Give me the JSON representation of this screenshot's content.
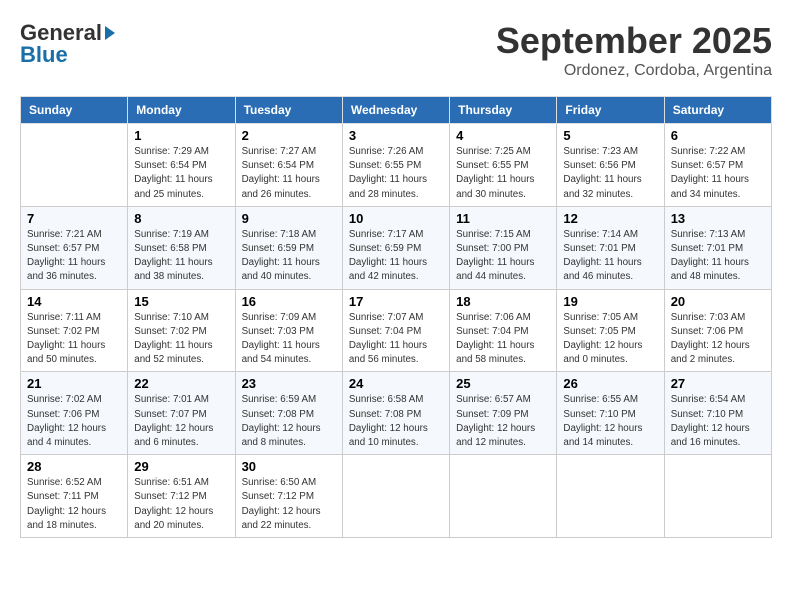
{
  "logo": {
    "line1": "General",
    "line2": "Blue"
  },
  "title": "September 2025",
  "location": "Ordonez, Cordoba, Argentina",
  "days_of_week": [
    "Sunday",
    "Monday",
    "Tuesday",
    "Wednesday",
    "Thursday",
    "Friday",
    "Saturday"
  ],
  "weeks": [
    [
      {
        "day": "",
        "sunrise": "",
        "sunset": "",
        "daylight": ""
      },
      {
        "day": "1",
        "sunrise": "Sunrise: 7:29 AM",
        "sunset": "Sunset: 6:54 PM",
        "daylight": "Daylight: 11 hours and 25 minutes."
      },
      {
        "day": "2",
        "sunrise": "Sunrise: 7:27 AM",
        "sunset": "Sunset: 6:54 PM",
        "daylight": "Daylight: 11 hours and 26 minutes."
      },
      {
        "day": "3",
        "sunrise": "Sunrise: 7:26 AM",
        "sunset": "Sunset: 6:55 PM",
        "daylight": "Daylight: 11 hours and 28 minutes."
      },
      {
        "day": "4",
        "sunrise": "Sunrise: 7:25 AM",
        "sunset": "Sunset: 6:55 PM",
        "daylight": "Daylight: 11 hours and 30 minutes."
      },
      {
        "day": "5",
        "sunrise": "Sunrise: 7:23 AM",
        "sunset": "Sunset: 6:56 PM",
        "daylight": "Daylight: 11 hours and 32 minutes."
      },
      {
        "day": "6",
        "sunrise": "Sunrise: 7:22 AM",
        "sunset": "Sunset: 6:57 PM",
        "daylight": "Daylight: 11 hours and 34 minutes."
      }
    ],
    [
      {
        "day": "7",
        "sunrise": "Sunrise: 7:21 AM",
        "sunset": "Sunset: 6:57 PM",
        "daylight": "Daylight: 11 hours and 36 minutes."
      },
      {
        "day": "8",
        "sunrise": "Sunrise: 7:19 AM",
        "sunset": "Sunset: 6:58 PM",
        "daylight": "Daylight: 11 hours and 38 minutes."
      },
      {
        "day": "9",
        "sunrise": "Sunrise: 7:18 AM",
        "sunset": "Sunset: 6:59 PM",
        "daylight": "Daylight: 11 hours and 40 minutes."
      },
      {
        "day": "10",
        "sunrise": "Sunrise: 7:17 AM",
        "sunset": "Sunset: 6:59 PM",
        "daylight": "Daylight: 11 hours and 42 minutes."
      },
      {
        "day": "11",
        "sunrise": "Sunrise: 7:15 AM",
        "sunset": "Sunset: 7:00 PM",
        "daylight": "Daylight: 11 hours and 44 minutes."
      },
      {
        "day": "12",
        "sunrise": "Sunrise: 7:14 AM",
        "sunset": "Sunset: 7:01 PM",
        "daylight": "Daylight: 11 hours and 46 minutes."
      },
      {
        "day": "13",
        "sunrise": "Sunrise: 7:13 AM",
        "sunset": "Sunset: 7:01 PM",
        "daylight": "Daylight: 11 hours and 48 minutes."
      }
    ],
    [
      {
        "day": "14",
        "sunrise": "Sunrise: 7:11 AM",
        "sunset": "Sunset: 7:02 PM",
        "daylight": "Daylight: 11 hours and 50 minutes."
      },
      {
        "day": "15",
        "sunrise": "Sunrise: 7:10 AM",
        "sunset": "Sunset: 7:02 PM",
        "daylight": "Daylight: 11 hours and 52 minutes."
      },
      {
        "day": "16",
        "sunrise": "Sunrise: 7:09 AM",
        "sunset": "Sunset: 7:03 PM",
        "daylight": "Daylight: 11 hours and 54 minutes."
      },
      {
        "day": "17",
        "sunrise": "Sunrise: 7:07 AM",
        "sunset": "Sunset: 7:04 PM",
        "daylight": "Daylight: 11 hours and 56 minutes."
      },
      {
        "day": "18",
        "sunrise": "Sunrise: 7:06 AM",
        "sunset": "Sunset: 7:04 PM",
        "daylight": "Daylight: 11 hours and 58 minutes."
      },
      {
        "day": "19",
        "sunrise": "Sunrise: 7:05 AM",
        "sunset": "Sunset: 7:05 PM",
        "daylight": "Daylight: 12 hours and 0 minutes."
      },
      {
        "day": "20",
        "sunrise": "Sunrise: 7:03 AM",
        "sunset": "Sunset: 7:06 PM",
        "daylight": "Daylight: 12 hours and 2 minutes."
      }
    ],
    [
      {
        "day": "21",
        "sunrise": "Sunrise: 7:02 AM",
        "sunset": "Sunset: 7:06 PM",
        "daylight": "Daylight: 12 hours and 4 minutes."
      },
      {
        "day": "22",
        "sunrise": "Sunrise: 7:01 AM",
        "sunset": "Sunset: 7:07 PM",
        "daylight": "Daylight: 12 hours and 6 minutes."
      },
      {
        "day": "23",
        "sunrise": "Sunrise: 6:59 AM",
        "sunset": "Sunset: 7:08 PM",
        "daylight": "Daylight: 12 hours and 8 minutes."
      },
      {
        "day": "24",
        "sunrise": "Sunrise: 6:58 AM",
        "sunset": "Sunset: 7:08 PM",
        "daylight": "Daylight: 12 hours and 10 minutes."
      },
      {
        "day": "25",
        "sunrise": "Sunrise: 6:57 AM",
        "sunset": "Sunset: 7:09 PM",
        "daylight": "Daylight: 12 hours and 12 minutes."
      },
      {
        "day": "26",
        "sunrise": "Sunrise: 6:55 AM",
        "sunset": "Sunset: 7:10 PM",
        "daylight": "Daylight: 12 hours and 14 minutes."
      },
      {
        "day": "27",
        "sunrise": "Sunrise: 6:54 AM",
        "sunset": "Sunset: 7:10 PM",
        "daylight": "Daylight: 12 hours and 16 minutes."
      }
    ],
    [
      {
        "day": "28",
        "sunrise": "Sunrise: 6:52 AM",
        "sunset": "Sunset: 7:11 PM",
        "daylight": "Daylight: 12 hours and 18 minutes."
      },
      {
        "day": "29",
        "sunrise": "Sunrise: 6:51 AM",
        "sunset": "Sunset: 7:12 PM",
        "daylight": "Daylight: 12 hours and 20 minutes."
      },
      {
        "day": "30",
        "sunrise": "Sunrise: 6:50 AM",
        "sunset": "Sunset: 7:12 PM",
        "daylight": "Daylight: 12 hours and 22 minutes."
      },
      {
        "day": "",
        "sunrise": "",
        "sunset": "",
        "daylight": ""
      },
      {
        "day": "",
        "sunrise": "",
        "sunset": "",
        "daylight": ""
      },
      {
        "day": "",
        "sunrise": "",
        "sunset": "",
        "daylight": ""
      },
      {
        "day": "",
        "sunrise": "",
        "sunset": "",
        "daylight": ""
      }
    ]
  ]
}
